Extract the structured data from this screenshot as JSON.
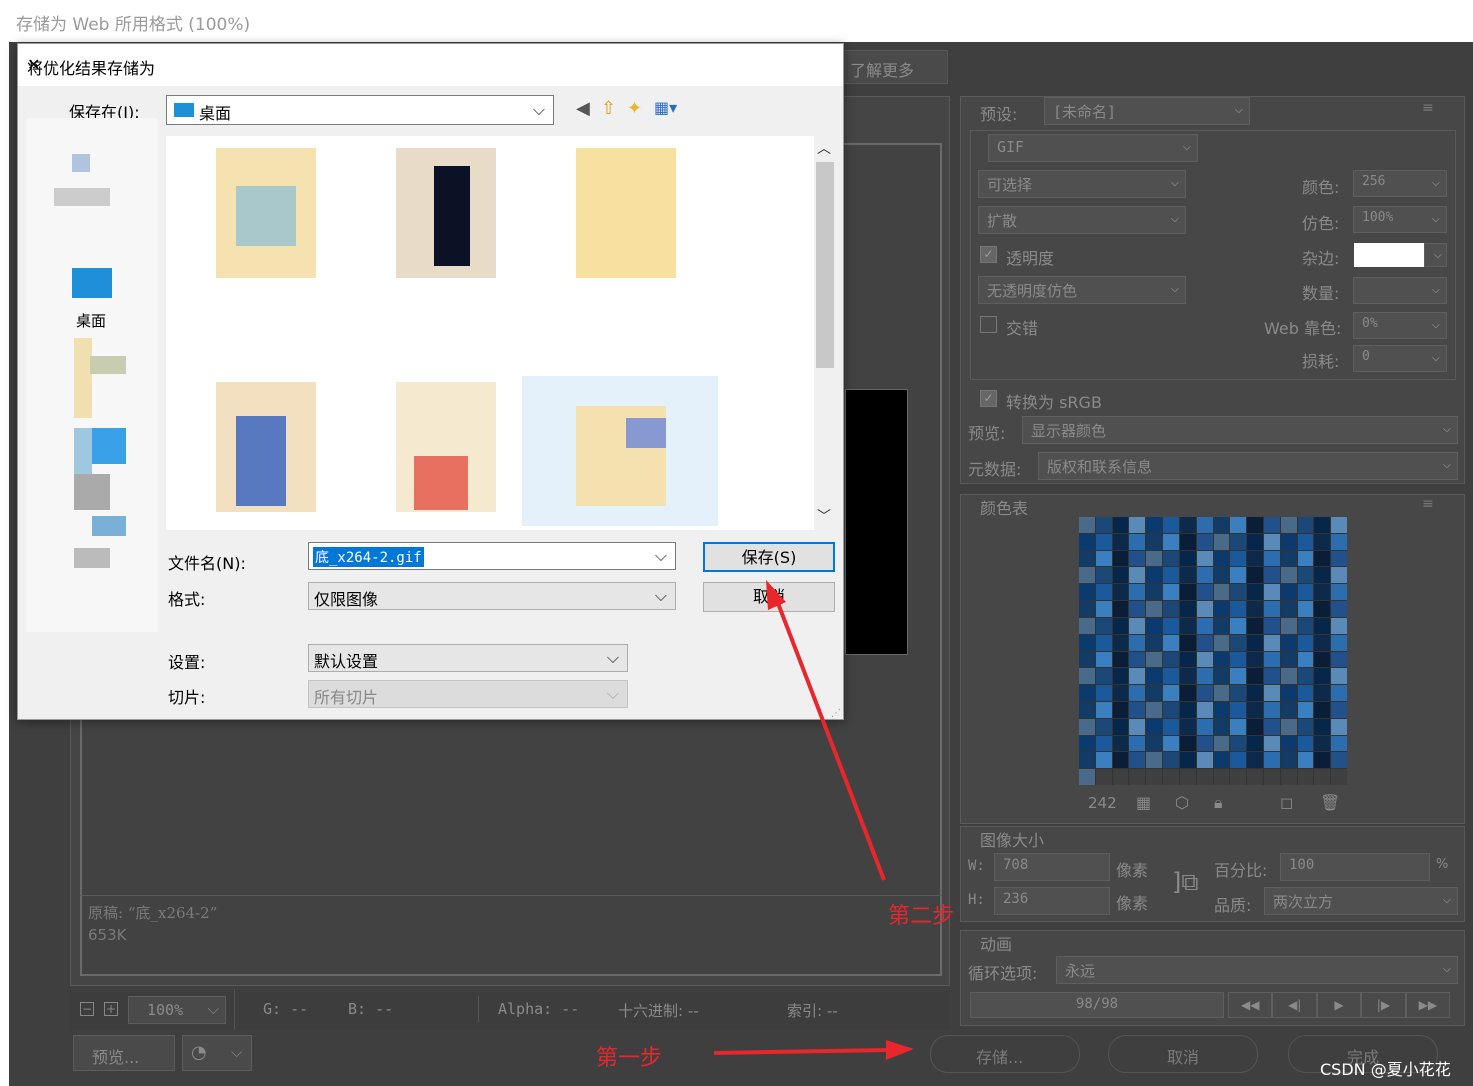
{
  "window_title": "存储为 Web 所用格式 (100%)",
  "learn_more": "了解更多",
  "right_panel": {
    "preset_label": "预设:",
    "preset_value": "[未命名]",
    "format": "GIF",
    "reduction": "可选择",
    "dither_algo": "扩散",
    "transparency_label": "透明度",
    "transparency_dither": "无透明度仿色",
    "interlaced_label": "交错",
    "colors_label": "颜色:",
    "colors_value": "256",
    "dither_label": "仿色:",
    "dither_value": "100%",
    "matte_label": "杂边:",
    "amount_label": "数量:",
    "websnap_label": "Web 靠色:",
    "websnap_value": "0%",
    "lossy_label": "损耗:",
    "lossy_value": "0",
    "convert_srgb": "转换为 sRGB",
    "preview_label": "预览:",
    "preview_value": "显示器颜色",
    "metadata_label": "元数据:",
    "metadata_value": "版权和联系信息",
    "color_table_label": "颜色表",
    "color_count": "242",
    "image_size_label": "图像大小",
    "w_label": "W:",
    "w_value": "708",
    "h_label": "H:",
    "h_value": "236",
    "pixels_unit": "像素",
    "percent_label": "百分比:",
    "percent_value": "100",
    "percent_sign": "%",
    "quality_label": "品质:",
    "quality_value": "两次立方",
    "animation_label": "动画",
    "loop_label": "循环选项:",
    "loop_value": "永远",
    "frame_counter": "98/98"
  },
  "preview_info": {
    "original_label": "原稿: “底_x264-2”",
    "original_size": "653K"
  },
  "status_bar": {
    "zoom": "100%",
    "g": "G: --",
    "b": "B: --",
    "alpha": "Alpha: --",
    "hex": "十六进制: --",
    "index": "索引: --"
  },
  "bottom_buttons": {
    "preview": "预览...",
    "save": "存储...",
    "cancel": "取消",
    "done": "完成"
  },
  "dialog": {
    "title": "将优化结果存储为",
    "save_in_label": "保存在(I):",
    "save_in_value": "桌面",
    "sidebar_desktop": "桌面",
    "filename_label": "文件名(N):",
    "filename_value": "底_x264-2.gif",
    "format_label": "格式:",
    "format_value": "仅限图像",
    "settings_label": "设置:",
    "settings_value": "默认设置",
    "slices_label": "切片:",
    "slices_value": "所有切片",
    "save_button": "保存(S)",
    "cancel_button": "取消"
  },
  "annotations": {
    "step1": "第一步",
    "step2": "第二步",
    "watermark": "CSDN @夏小花花"
  },
  "colors": {
    "ps_bg": "#3f3f3f",
    "annotation_red": "#e8262b"
  }
}
